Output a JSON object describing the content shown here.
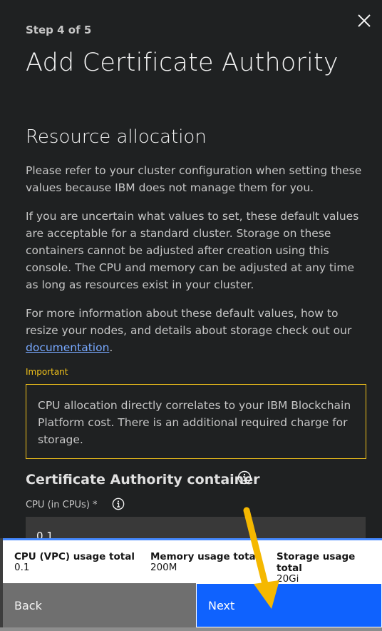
{
  "header": {
    "step": "Step 4 of 5",
    "title": "Add Certificate Authority"
  },
  "section": {
    "title": "Resource allocation",
    "paragraph1": "Please refer to your cluster configuration when setting these values because IBM does not manage them for you.",
    "paragraph2": "If you are uncertain what values to set, these default values are acceptable for a standard cluster. Storage on these containers cannot be adjusted after creation using this console. The CPU and memory can be adjusted at any time as long as resources exist in your cluster.",
    "paragraph3_text": "For more information about these default values, how to resize your nodes, and details about storage check out our",
    "paragraph3_link": "documentation",
    "paragraph3_end": "."
  },
  "important": {
    "label": "Important",
    "text": "CPU allocation directly correlates to your IBM Blockchain Platform cost. There is an additional required charge for storage."
  },
  "container": {
    "title": "Certificate Authority container",
    "cpu_label": "CPU (in CPUs) *",
    "cpu_value": "0.1"
  },
  "usage": {
    "cpu_title": "CPU (VPC) usage total",
    "cpu_value": "0.1",
    "memory_title": "Memory usage total",
    "memory_value": "200M",
    "storage_title": "Storage usage total",
    "storage_value": "20Gi"
  },
  "buttons": {
    "back": "Back",
    "next": "Next"
  },
  "icons": {
    "close": "close-icon",
    "info": "info-icon",
    "annotation_arrow": "arrow-icon"
  },
  "colors": {
    "warning": "#f1c21b",
    "primary": "#0f62fe",
    "link": "#78a9ff",
    "arrow": "#f5b800"
  }
}
